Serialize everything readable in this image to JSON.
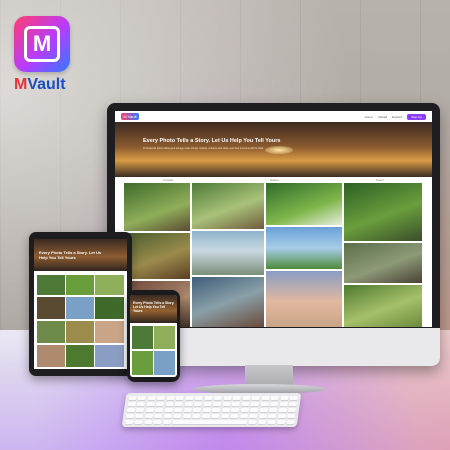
{
  "brand": {
    "logo_letter": "M",
    "name_first": "M",
    "name_rest": "Vault",
    "accent": "#8c3cff"
  },
  "site": {
    "logo_text": "M Vault",
    "nav_links": [
      "Home",
      "Upload",
      "Explore"
    ],
    "nav_button": "Sign Up",
    "hero_title": "Every Photo Tells a Story. Let Us Help You Tell Yours",
    "hero_subtitle": "Professional photo editing and storage made simple. Upload, enhance and share your best moments with M Vault.",
    "tabs": [
      "Popular",
      "Nature",
      "Travel"
    ]
  },
  "tablet": {
    "hero_title": "Every Photo Tells a Story. Let Us Help You Tell Yours"
  },
  "phone": {
    "hero_title": "Every Photo Tells a Story. Let Us Help You Tell Yours"
  },
  "colors": {
    "primary": "#8c3cff",
    "logo_red": "#e8333a",
    "logo_blue": "#1b4fc4"
  }
}
